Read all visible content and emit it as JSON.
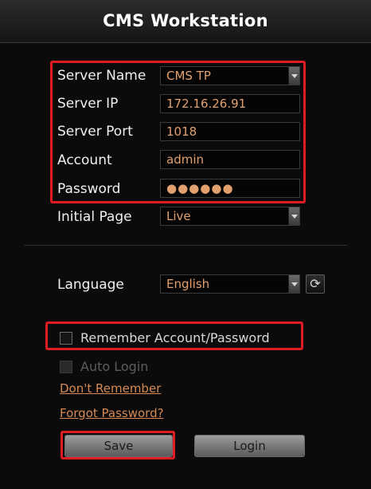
{
  "window": {
    "title": "CMS Workstation"
  },
  "form": {
    "server_name": {
      "label": "Server Name",
      "value": "CMS TP"
    },
    "server_ip": {
      "label": "Server IP",
      "value": "172.16.26.91"
    },
    "server_port": {
      "label": "Server Port",
      "value": "1018"
    },
    "account": {
      "label": "Account",
      "value": "admin"
    },
    "password": {
      "label": "Password",
      "value": "●●●●●●"
    },
    "initial_page": {
      "label": "Initial Page",
      "value": "Live"
    },
    "language": {
      "label": "Language",
      "value": "English"
    }
  },
  "options": {
    "remember": {
      "label": "Remember Account/Password",
      "checked": false
    },
    "auto_login": {
      "label": "Auto Login",
      "checked": false,
      "enabled": false
    }
  },
  "links": {
    "dont_remember": "Don't Remember",
    "forgot_password": "Forgot Password?"
  },
  "buttons": {
    "save": "Save",
    "login": "Login"
  },
  "icons": {
    "refresh": "refresh-icon",
    "dropdown": "chevron-down-icon"
  },
  "colors": {
    "highlight": "#e11b22",
    "field_text": "#e2a06f",
    "link": "#d58a55"
  }
}
